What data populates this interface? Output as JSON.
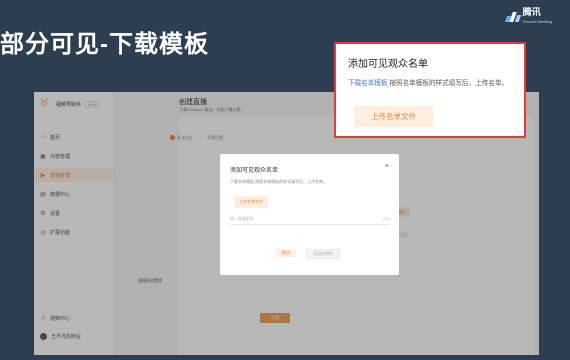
{
  "slide": {
    "title": "部分可见-下载模板"
  },
  "brand": {
    "name": "腾讯",
    "sub": "Tencent Meeting"
  },
  "sidebar": {
    "app_name": "视频号助手",
    "app_tag": "Beta",
    "items": [
      {
        "icon": "home-icon",
        "label": "首页"
      },
      {
        "icon": "content-icon",
        "label": "内容管理"
      },
      {
        "icon": "live-icon",
        "label": "直播管理"
      },
      {
        "icon": "data-icon",
        "label": "数据中心"
      },
      {
        "icon": "settings-icon",
        "label": "设置"
      },
      {
        "icon": "extend-icon",
        "label": "扩展功能"
      }
    ],
    "notifications": "通知中心",
    "account": "王不凡的商业"
  },
  "main": {
    "title": "创建直播",
    "subtitle": "下载Windows 推流，也能开播方便。",
    "steps": [
      "基本信息",
      "开播设置"
    ],
    "side_button": "添加观众",
    "side_label": "可见",
    "field_label": "直播间设置等",
    "submit": "创建"
  },
  "modal": {
    "title": "添加可见观众名单",
    "desc": "下载名单模板 按照名单模板的样式填写后，上传名单。",
    "upload": "上传名单文件",
    "input_placeholder": "输入观看昵称",
    "count": "0/10",
    "cancel": "取消",
    "confirm": "添加并保存"
  },
  "callout": {
    "title": "添加可见观众名单",
    "desc_link": "下载名单模板",
    "desc_rest": " 按照名单模板的样式填写后，上传名单。",
    "button": "上传名单文件",
    "border_color": "#e23c3c"
  }
}
